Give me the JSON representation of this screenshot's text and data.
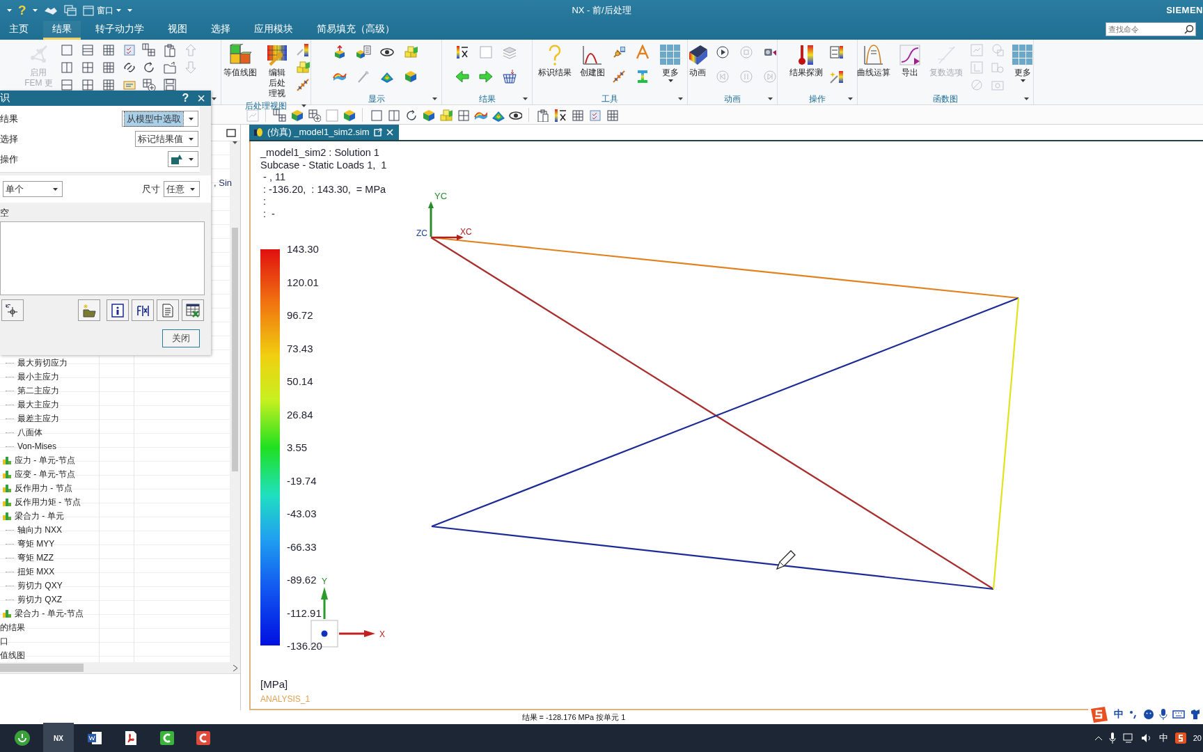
{
  "window": {
    "title": "NX - 前/后处理",
    "brand": "SIEMEN"
  },
  "quick_access": {
    "help": "?",
    "window_menu": "窗口"
  },
  "menu_tabs": [
    {
      "label": "主页",
      "selected": false
    },
    {
      "label": "结果",
      "selected": true
    },
    {
      "label": "转子动力学",
      "selected": false
    },
    {
      "label": "视图",
      "selected": false
    },
    {
      "label": "选择",
      "selected": false
    },
    {
      "label": "应用模块",
      "selected": false
    },
    {
      "label": "简易填充（高级）",
      "selected": false
    }
  ],
  "search": {
    "placeholder": "查找命令"
  },
  "ribbon": {
    "groups": [
      {
        "tools": [
          {
            "label": "启用\nFEM 更",
            "disabled": true
          }
        ]
      },
      {
        "label": "后处理视图",
        "tools": [
          {
            "label": "等值线图",
            "disabled": false
          },
          {
            "label": "编辑后处理视",
            "disabled": false
          }
        ]
      },
      {
        "label": "显示"
      },
      {
        "label": "结果"
      },
      {
        "label": "工具",
        "tools": [
          {
            "label": "标识结果",
            "disabled": false
          },
          {
            "label": "创建图",
            "disabled": false
          },
          {
            "label": "更多",
            "disabled": false
          }
        ]
      },
      {
        "label": "动画",
        "tools": [
          {
            "label": "动画",
            "disabled": false
          }
        ]
      },
      {
        "label": "操作",
        "tools": [
          {
            "label": "结果探测",
            "disabled": false
          }
        ]
      },
      {
        "label": "函数图",
        "tools": [
          {
            "label": "曲线运算",
            "disabled": false
          },
          {
            "label": "导出",
            "disabled": false
          },
          {
            "label": "复数选项",
            "disabled": true
          },
          {
            "label": "更多",
            "disabled": false
          }
        ]
      }
    ]
  },
  "dialog": {
    "title": "识",
    "help": "?",
    "close": "×",
    "fields": [
      {
        "label": "结果",
        "kind": "text",
        "value": "从模型中选取",
        "focused": true
      },
      {
        "label": "选择",
        "kind": "text",
        "value": "标记结果值",
        "focused": false
      },
      {
        "label": "操作",
        "kind": "icon"
      }
    ],
    "mode": {
      "value": "单个"
    },
    "size": {
      "label": "尺寸",
      "value": "任意"
    },
    "list": {
      "label": "空"
    },
    "close_button": "关闭"
  },
  "navigator": {
    "cell_fragment": ", Sin",
    "tree": [
      {
        "kind": "leaf",
        "label": "最大剪切应力"
      },
      {
        "kind": "leaf",
        "label": "最小主应力"
      },
      {
        "kind": "leaf",
        "label": "第二主应力"
      },
      {
        "kind": "leaf",
        "label": "最大主应力"
      },
      {
        "kind": "leaf",
        "label": "最差主应力"
      },
      {
        "kind": "leaf",
        "label": "八面体"
      },
      {
        "kind": "leaf",
        "label": "Von-Mises"
      },
      {
        "kind": "group",
        "label": "应力 - 单元-节点"
      },
      {
        "kind": "group",
        "label": "应变 - 单元-节点"
      },
      {
        "kind": "group",
        "label": "反作用力 - 节点"
      },
      {
        "kind": "group",
        "label": "反作用力矩 - 节点"
      },
      {
        "kind": "group",
        "label": "梁合力 - 单元",
        "children": [
          {
            "kind": "leaf",
            "label": "轴向力 NXX"
          },
          {
            "kind": "leaf",
            "label": "弯矩 MYY"
          },
          {
            "kind": "leaf",
            "label": "弯矩 MZZ"
          },
          {
            "kind": "leaf",
            "label": "扭矩 MXX"
          },
          {
            "kind": "leaf",
            "label": "剪切力 QXY"
          },
          {
            "kind": "leaf",
            "label": "剪切力 QXZ"
          }
        ]
      },
      {
        "kind": "group",
        "label": "梁合力 - 单元-节点"
      },
      {
        "kind": "root",
        "label": "的结果"
      },
      {
        "kind": "root",
        "label": "口"
      },
      {
        "kind": "root",
        "label": "值线图"
      }
    ]
  },
  "viewport": {
    "tab": "(仿真) _model1_sim2.sim",
    "info": [
      "_model1_sim2 : Solution 1",
      "Subcase - Static Loads 1,  1",
      " - , 11",
      " : -136.20,  : 143.30,  = MPa",
      " :",
      " :  -"
    ],
    "legend": {
      "values": [
        "143.30",
        "120.01",
        "96.72",
        "73.43",
        "50.14",
        "26.84",
        "3.55",
        "-19.74",
        "-43.03",
        "-66.33",
        "-89.62",
        "-112.91",
        "-136.20"
      ],
      "unit": "[MPa]"
    },
    "view_name": "ANALYSIS_1",
    "axes": {
      "yc": "YC",
      "xc": "XC",
      "zc": "ZC",
      "y": "Y",
      "x": "X"
    },
    "elements": [
      {
        "color": "#e0821f"
      },
      {
        "color": "#a82e2e"
      },
      {
        "color": "#1c2a96"
      },
      {
        "color": "#1c2a96"
      },
      {
        "color": "#e2e21c"
      }
    ]
  },
  "status_bar": {
    "text": "结果 = -128.176 MPa 按单元 1"
  },
  "ime_bar": {
    "mode": "中"
  },
  "taskbar": {
    "active_app": "NX",
    "tray_ime": "中",
    "clock": "20"
  }
}
